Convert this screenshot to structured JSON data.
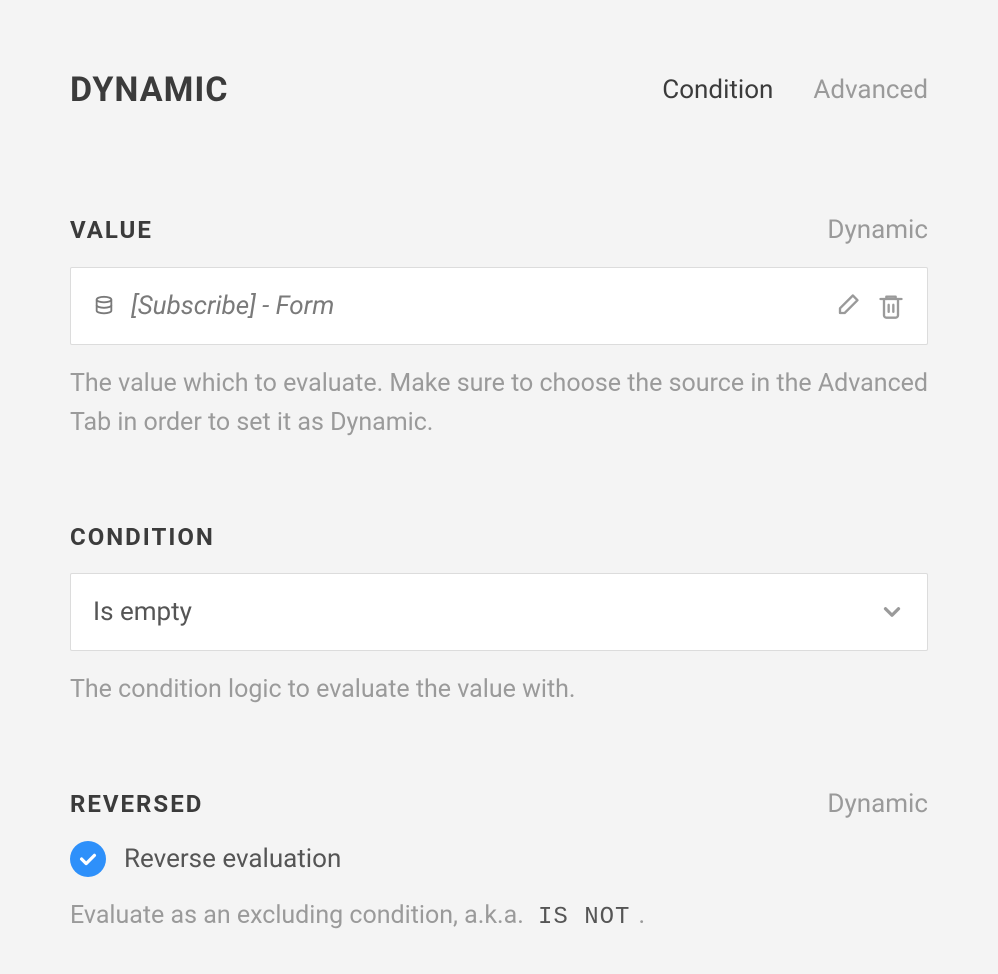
{
  "header": {
    "title": "DYNAMIC",
    "tabs": {
      "condition": "Condition",
      "advanced": "Advanced"
    }
  },
  "sections": {
    "value": {
      "label": "VALUE",
      "badge": "Dynamic",
      "input_text": "[Subscribe] - Form",
      "help": "The value which to evaluate. Make sure to choose the source in the Advanced Tab in order to set it as Dynamic."
    },
    "condition": {
      "label": "CONDITION",
      "selected": "Is empty",
      "help": "The condition logic to evaluate the value with."
    },
    "reversed": {
      "label": "REVERSED",
      "badge": "Dynamic",
      "checkbox_label": "Reverse evaluation",
      "checkbox_checked": true,
      "help_prefix": "Evaluate as an excluding condition, a.k.a. ",
      "help_code": "IS NOT",
      "help_suffix": "."
    }
  }
}
